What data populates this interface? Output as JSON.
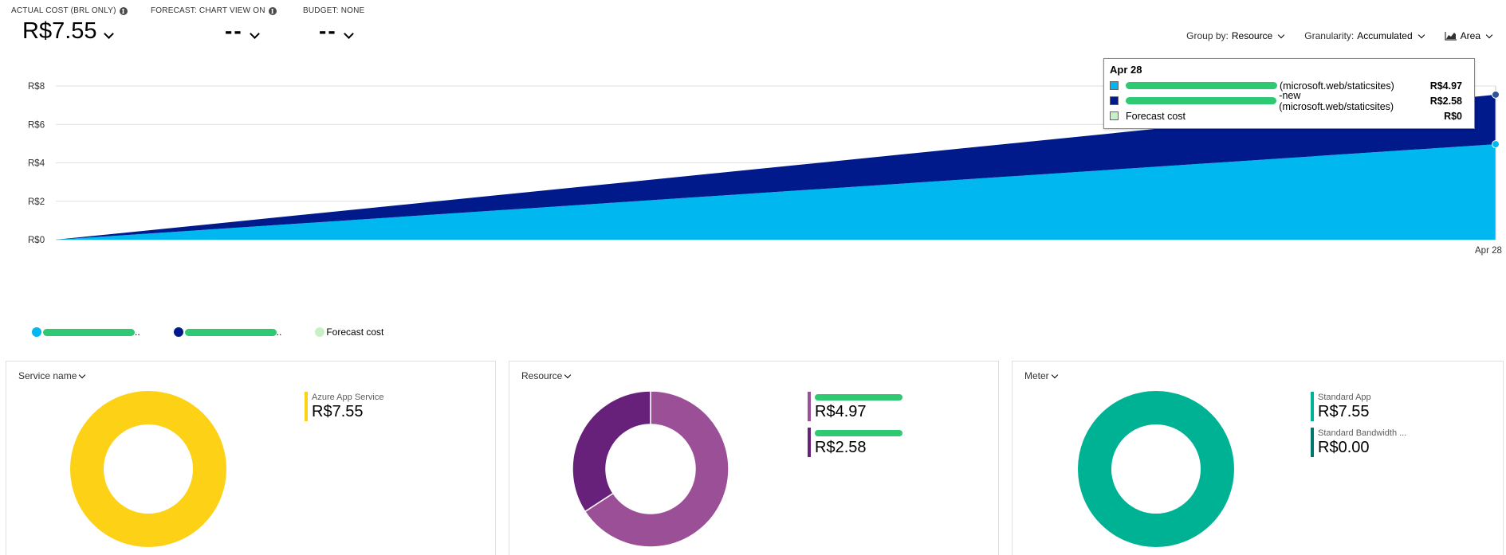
{
  "kpis": {
    "actual": {
      "label": "ACTUAL COST (BRL ONLY)",
      "value": "R$7.55"
    },
    "forecast": {
      "label": "FORECAST: CHART VIEW ON",
      "value": "--"
    },
    "budget": {
      "label": "BUDGET: NONE",
      "value": "--"
    }
  },
  "toolbar": {
    "group_by_label": "Group by:",
    "group_by_value": "Resource",
    "granularity_label": "Granularity:",
    "granularity_value": "Accumulated",
    "chart_type_value": "Area"
  },
  "colors": {
    "series_light": "#00b7f0",
    "series_dark": "#001a8c",
    "forecast": "#c7f0c7",
    "service_donut": "#fcd116",
    "resource_donut_1": "#9b4f96",
    "resource_donut_2": "#68217a",
    "meter_donut": "#00b294",
    "meter_donut_2": "#00776b",
    "redaction": "#2fc873"
  },
  "chart_data": {
    "type": "area",
    "x": [
      "",
      "Apr 28"
    ],
    "x_tick_labels": [
      "Apr 28"
    ],
    "y_tick_labels": [
      "R$0",
      "R$2",
      "R$4",
      "R$6",
      "R$8"
    ],
    "ylim": [
      0,
      8
    ],
    "stacked": true,
    "series": [
      {
        "values": [
          0,
          4.97
        ],
        "color": "#00b7f0"
      },
      {
        "values": [
          0,
          2.58
        ],
        "color": "#001a8c"
      },
      {
        "name": "Forecast cost",
        "values": [
          0,
          0
        ],
        "color": "#c7f0c7"
      }
    ]
  },
  "tooltip": {
    "date": "Apr 28",
    "rows": [
      {
        "suffix": " (microsoft.web/staticsites)",
        "value": "R$4.97",
        "color": "#00b7f0",
        "redact": true
      },
      {
        "suffix": "-new (microsoft.web/staticsites)",
        "value": "R$2.58",
        "color": "#001a8c",
        "redact": true
      },
      {
        "suffix": "Forecast cost",
        "value": "R$0",
        "color": "#c7f0c7",
        "redact": false
      }
    ]
  },
  "legend": {
    "items": [
      {
        "suffix": "..",
        "color": "#00b7f0"
      },
      {
        "suffix": "..",
        "color": "#001a8c"
      },
      {
        "suffix": "Forecast cost",
        "color": "#c7f0c7"
      }
    ]
  },
  "cards": {
    "service": {
      "header": "Service name",
      "items": [
        {
          "label": "Azure App Service",
          "value": "R$7.55",
          "color": "#fcd116"
        }
      ],
      "donut_values": [
        7.55
      ]
    },
    "resource": {
      "header": "Resource",
      "items": [
        {
          "value": "R$4.97",
          "color": "#9b4f96"
        },
        {
          "value": "R$2.58",
          "color": "#68217a"
        }
      ],
      "donut_values": [
        4.97,
        2.58
      ]
    },
    "meter": {
      "header": "Meter",
      "items": [
        {
          "label": "Standard App",
          "value": "R$7.55",
          "color": "#00b294"
        },
        {
          "label": "Standard Bandwidth ...",
          "value": "R$0.00",
          "color": "#00776b"
        }
      ],
      "donut_values": [
        7.55,
        0.0
      ]
    }
  }
}
